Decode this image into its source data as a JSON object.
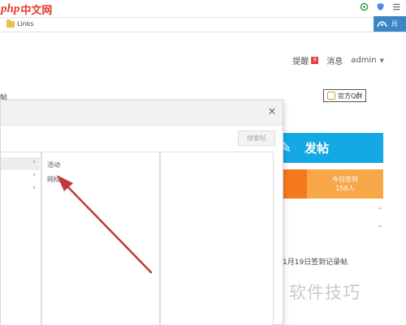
{
  "browser": {
    "logo_php": "php",
    "logo_cn": "中文网",
    "bookmark_folder": "Links",
    "ext_label": "局"
  },
  "site_header": {
    "reminders": "提醒",
    "reminder_count": "9",
    "messages": "消息",
    "user": "admin"
  },
  "left_fragment": "帖",
  "official_group": "官方Q群",
  "dialog": {
    "close": "×",
    "search_btn": "搜索帖",
    "subcategories": [
      "活动",
      "网校"
    ]
  },
  "post_banner": {
    "label": "发帖"
  },
  "signin": {
    "title": "今日签到",
    "count": "158人"
  },
  "signin_thread": "1月19日签到记录帖",
  "watermark": "软件技巧",
  "colors": {
    "accent_blue": "#14a9e5",
    "orange": "#f57a1e",
    "light_orange": "#f7a748",
    "arrow_red": "#c0393b",
    "badge_red": "#e03b3b"
  }
}
